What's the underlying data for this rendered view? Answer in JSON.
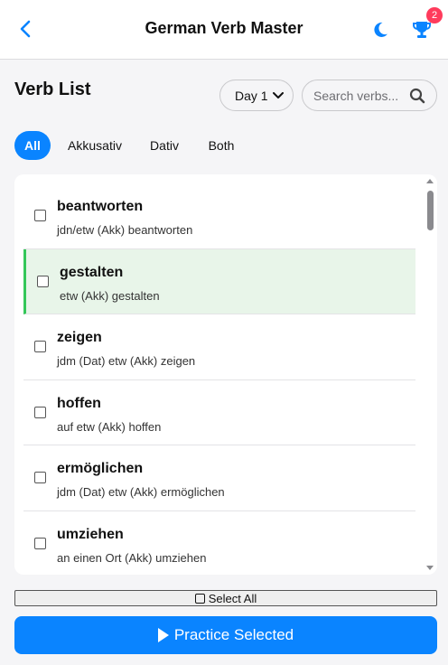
{
  "header": {
    "title": "German Verb Master",
    "back_icon": "chevron-left-icon",
    "theme_icon": "moon-icon",
    "trophy_icon": "trophy-icon",
    "trophy_badge": "2",
    "accent_color": "#0a84ff",
    "badge_color": "#ff3b5c"
  },
  "toolbar": {
    "list_title": "Verb List",
    "day_selected": "Day 1",
    "search_placeholder": "Search verbs..."
  },
  "filters": {
    "tabs": [
      "All",
      "Akkusativ",
      "Dativ",
      "Both"
    ],
    "active": "All"
  },
  "verbs": [
    {
      "verb": "beantworten",
      "usage": "jdn/etw (Akk) beantworten",
      "selected": false
    },
    {
      "verb": "gestalten",
      "usage": "etw (Akk) gestalten",
      "selected": true
    },
    {
      "verb": "zeigen",
      "usage": "jdm (Dat) etw (Akk) zeigen",
      "selected": false
    },
    {
      "verb": "hoffen",
      "usage": "auf etw (Akk) hoffen",
      "selected": false
    },
    {
      "verb": "ermöglichen",
      "usage": "jdm (Dat) etw (Akk) ermöglichen",
      "selected": false
    },
    {
      "verb": "umziehen",
      "usage": "an einen Ort (Akk) umziehen",
      "selected": false
    }
  ],
  "selected_color": "#34c759",
  "actions": {
    "select_all": "Select All",
    "practice": "Practice Selected"
  }
}
